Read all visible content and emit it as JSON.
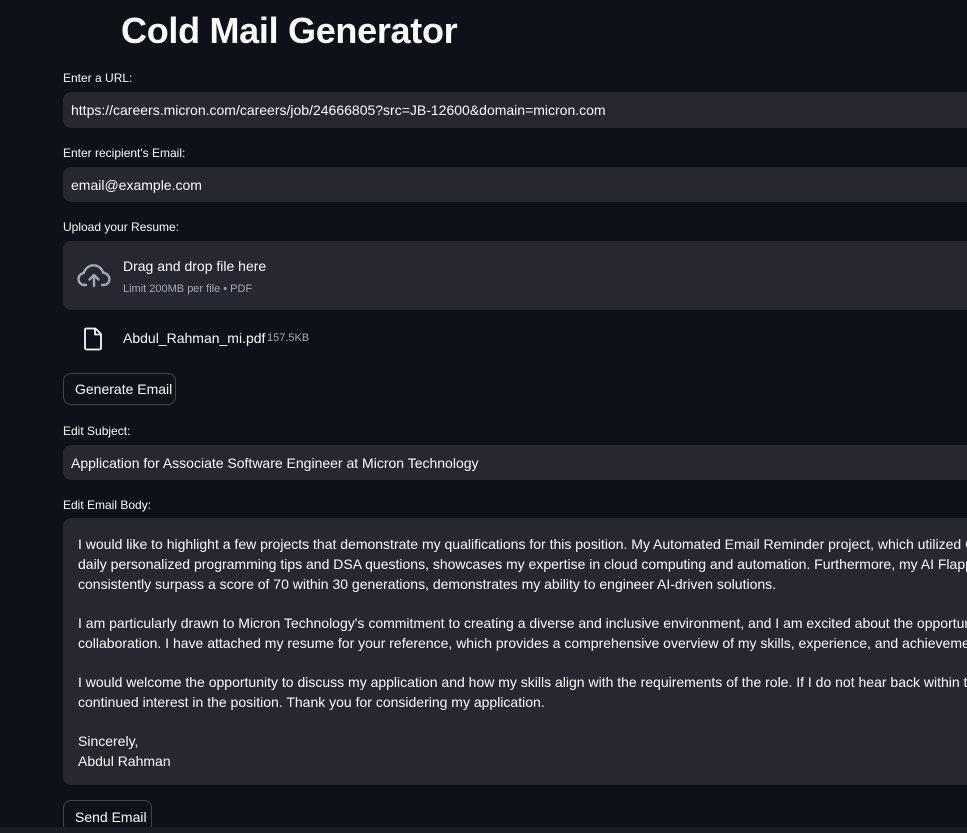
{
  "page": {
    "title": "Cold Mail Generator"
  },
  "url_field": {
    "label": "Enter a URL:",
    "value": "https://careers.micron.com/careers/job/24666805?src=JB-12600&domain=micron.com"
  },
  "email_field": {
    "label": "Enter recipient's Email:",
    "value": "email@example.com"
  },
  "uploader": {
    "label": "Upload your Resume:",
    "drop_text": "Drag and drop file here",
    "limit_text": "Limit 200MB per file • PDF",
    "icon": "cloud-upload-icon",
    "file": {
      "icon": "file-icon",
      "name": "Abdul_Rahman_mi.pdf",
      "size": "157.5KB"
    }
  },
  "generate_button": {
    "label": "Generate Email"
  },
  "subject_field": {
    "label": "Edit Subject:",
    "value": "Application for Associate Software Engineer at Micron Technology"
  },
  "body_field": {
    "label": "Edit Email Body:",
    "lines": [
      "I would like to highlight a few projects that demonstrate my qualifications for this position. My Automated Email Reminder project, which utilized GitHub",
      "daily personalized programming tips and DSA questions, showcases my expertise in cloud computing and automation. Furthermore, my AI Flappy Bird p",
      "consistently surpass a score of 70 within 30 generations, demonstrates my ability to engineer AI-driven solutions.",
      "I am particularly drawn to Micron Technology's commitment to creating a diverse and inclusive environment, and I am excited about the opportunity to c",
      "collaboration. I have attached my resume for your reference, which provides a comprehensive overview of my skills, experience, and achievements.",
      "I would welcome the opportunity to discuss my application and how my skills align with the requirements of the role. If I do not hear back within the nex",
      "continued interest in the position. Thank you for considering my application.",
      "Sincerely,",
      "Abdul Rahman"
    ]
  },
  "send_button": {
    "label": "Send Email"
  },
  "colors": {
    "background": "#0e1117",
    "input_background": "#262730",
    "text": "#fafafa",
    "muted_text": "#a3a8b8"
  }
}
